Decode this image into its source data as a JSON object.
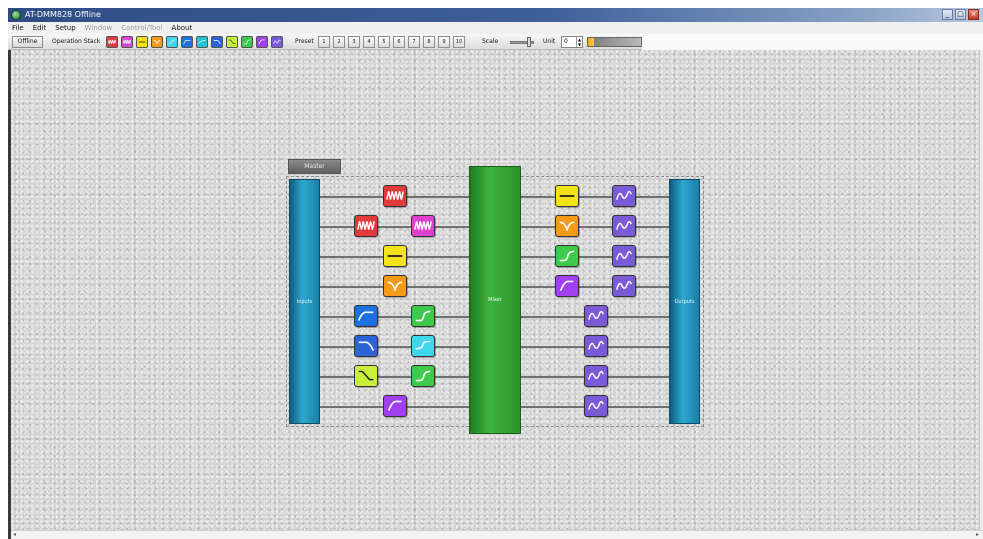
{
  "window": {
    "title": "AT-DMM828 Offline",
    "buttons": [
      "_",
      "□",
      "×"
    ]
  },
  "menu": [
    {
      "label": "File",
      "enabled": true
    },
    {
      "label": "Edit",
      "enabled": true
    },
    {
      "label": "Setup",
      "enabled": true
    },
    {
      "label": "Window",
      "enabled": false
    },
    {
      "label": "Control/Tool",
      "enabled": false
    },
    {
      "label": "About",
      "enabled": true
    }
  ],
  "toolbar": {
    "offline_label": "Offline",
    "operation_stack_label": "Operation Stack",
    "stack_icons": [
      {
        "name": "limiter-icon",
        "color": "#e03a3a"
      },
      {
        "name": "compressor-icon",
        "color": "#e040d0"
      },
      {
        "name": "gain-icon",
        "color": "#f2e21a"
      },
      {
        "name": "notch-eq-icon",
        "color": "#f39a1a"
      },
      {
        "name": "shelf-eq-icon",
        "color": "#3fd6ee"
      },
      {
        "name": "high-pass-icon",
        "color": "#1e6fe0"
      },
      {
        "name": "pass-filter-icon",
        "color": "#26c2d6"
      },
      {
        "name": "low-pass-icon",
        "color": "#2a64d8"
      },
      {
        "name": "slope-icon",
        "color": "#c8ef3a"
      },
      {
        "name": "rise-filter-icon",
        "color": "#3cc94c"
      },
      {
        "name": "crossover-icon",
        "color": "#a040f0"
      },
      {
        "name": "graphic-eq-icon",
        "color": "#7a5ad6"
      }
    ],
    "preset_label": "Preset",
    "presets": [
      "1",
      "2",
      "3",
      "4",
      "5",
      "6",
      "7",
      "8",
      "9",
      "10"
    ],
    "scale_label": "Scale",
    "unit_label": "Unit",
    "unit_value": "0",
    "meter_level": 0.12
  },
  "schematic": {
    "tab_label": "Master",
    "inputs_label": "Inputs",
    "mixer_label": "Mixer",
    "outputs_label": "Outputs",
    "colors": {
      "bus": "#1f8fb8",
      "mixer": "#2e9a2e",
      "wire": "#707070"
    }
  }
}
